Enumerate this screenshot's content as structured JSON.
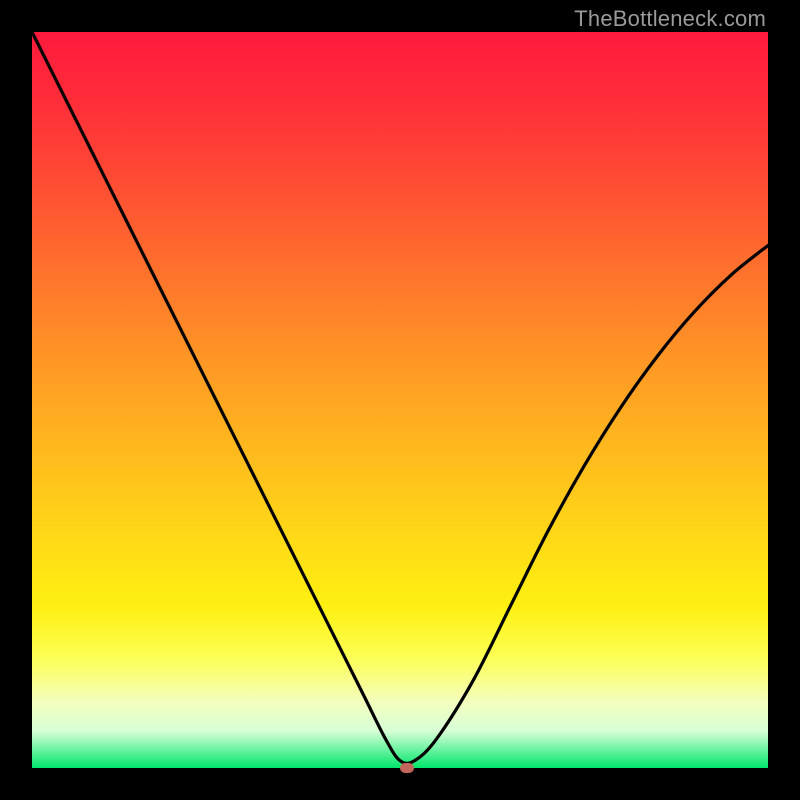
{
  "watermark": "TheBottleneck.com",
  "colors": {
    "frame": "#000000",
    "curve": "#000000",
    "marker": "#c0665a",
    "gradient_top": "#ff1a3d",
    "gradient_bottom": "#00e66b"
  },
  "chart_data": {
    "type": "line",
    "title": "",
    "xlabel": "",
    "ylabel": "",
    "xlim": [
      0,
      100
    ],
    "ylim": [
      0,
      100
    ],
    "grid": false,
    "legend": false,
    "series": [
      {
        "name": "bottleneck-curve",
        "x": [
          0,
          5,
          10,
          15,
          20,
          25,
          30,
          35,
          40,
          45,
          48,
          50,
          52,
          55,
          60,
          65,
          70,
          75,
          80,
          85,
          90,
          95,
          100
        ],
        "values": [
          100,
          90,
          80,
          70,
          60,
          50,
          40,
          30,
          20,
          10,
          4,
          1,
          1,
          4,
          12,
          22,
          32,
          41,
          49,
          56,
          62,
          67,
          71
        ]
      }
    ],
    "marker": {
      "x": 51,
      "y": 0
    },
    "annotations": []
  }
}
